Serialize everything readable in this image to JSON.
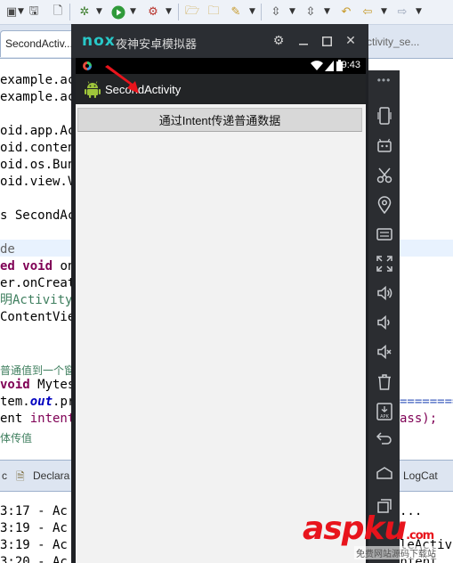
{
  "ide": {
    "editor_tab": "SecondActiv...",
    "editor_tab_right": "ctivity_se...",
    "code_lines": [
      {
        "text": "example.ac"
      },
      {
        "text": "example.ac"
      },
      {
        "text": ""
      },
      {
        "text": "oid.app.Ac"
      },
      {
        "text": "oid.conten"
      },
      {
        "text": "oid.os.Bun"
      },
      {
        "text": "oid.view.V"
      },
      {
        "text": ""
      },
      {
        "text": "s SecondAc"
      },
      {
        "text": ""
      },
      {
        "text": "de"
      },
      {
        "kw": "ed void",
        "text": " on"
      },
      {
        "text": "er.onCreat"
      },
      {
        "comment": "明Activity"
      },
      {
        "text": "ContentVie"
      },
      {
        "text": ""
      },
      {
        "text": ""
      },
      {
        "comment": "普通值到一个窗"
      },
      {
        "kw": "void",
        "text": " Mytes"
      },
      {
        "text": "tem.",
        "field": "out",
        "text2": ".pr"
      },
      {
        "text": "ent ",
        "kw2": "intent"
      },
      {
        "comment": "体传值"
      }
    ],
    "code_right_line_eq": "==========",
    "code_right_line_ass": "ass);",
    "bottom_tabs": {
      "tab_1": "c",
      "tab_declaration": "Declara",
      "tab_logcat": "LogCat"
    },
    "console_lines": [
      {
        "time": "3:17 - Ac",
        "tail": "..."
      },
      {
        "time": "3:19 - Ac",
        "tail": ""
      },
      {
        "time": "3:19 - Ac",
        "tail": "leActiv"
      },
      {
        "time": "3:20 - Ac",
        "tail": "Intent"
      }
    ]
  },
  "nox": {
    "logo": "nox",
    "title": "夜神安卓模拟器",
    "status_time": "9:43",
    "app_title": "SecondActivity",
    "button_label": "通过Intent传递普通数据",
    "sidebar_more": "•••",
    "sidebar_icons": [
      "phone-rotate-icon",
      "android-robot-icon",
      "scissors-icon",
      "location-pin-icon",
      "keyboard-icon",
      "fullscreen-icon",
      "volume-up-icon",
      "volume-down-icon",
      "volume-mute-icon",
      "trash-icon",
      "apk-install-icon",
      "back-icon",
      "home-icon",
      "recent-apps-icon"
    ]
  },
  "watermark": {
    "logo": "aspku",
    "logo_suffix": ".com",
    "sub": "免费网站源码下载站"
  },
  "colors": {
    "keyword": "#7f0055",
    "comment": "#3f7f5f",
    "field": "#0000c0",
    "nox_teal": "#28c8c8",
    "arrow_red": "#e8141c"
  }
}
